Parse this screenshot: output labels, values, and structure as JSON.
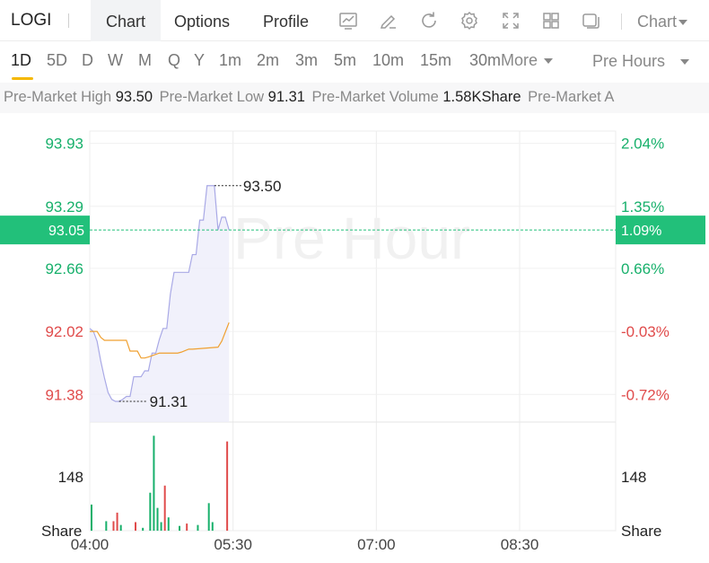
{
  "header": {
    "symbol": "LOGI",
    "tabs": [
      {
        "label": "Chart",
        "active": true
      },
      {
        "label": "Options",
        "active": false
      },
      {
        "label": "Profile",
        "active": false
      }
    ],
    "toolbar_icons": [
      "indicator-icon",
      "draw-icon",
      "refresh-icon",
      "settings-icon",
      "fullscreen-icon",
      "layout-grid-icon",
      "window-icon"
    ],
    "chart_type_label": "Chart"
  },
  "periods": {
    "items": [
      "1D",
      "5D",
      "D",
      "W",
      "M",
      "Q",
      "Y",
      "1m",
      "2m",
      "3m",
      "5m",
      "10m",
      "15m",
      "30m"
    ],
    "active": "1D",
    "more_label": "More",
    "session_label": "Pre Hours"
  },
  "stats": [
    {
      "label": "Pre-Market High",
      "value": "93.50"
    },
    {
      "label": "Pre-Market Low",
      "value": "91.31"
    },
    {
      "label": "Pre-Market Volume",
      "value": "1.58KShare"
    },
    {
      "label": "Pre-Market A",
      "value": ""
    }
  ],
  "chart": {
    "watermark": "Pre Hour",
    "current_price": "93.05",
    "current_change": "1.09%",
    "high_label": "93.50",
    "low_label": "91.31",
    "volume_tick": "148",
    "volume_unit": "Share",
    "price_ticks": [
      {
        "price": "93.93",
        "pct": "2.04%",
        "dir": "up"
      },
      {
        "price": "93.29",
        "pct": "1.35%",
        "dir": "up"
      },
      {
        "price": "92.66",
        "pct": "0.66%",
        "dir": "up"
      },
      {
        "price": "92.02",
        "pct": "-0.03%",
        "dir": "down"
      },
      {
        "price": "91.38",
        "pct": "-0.72%",
        "dir": "down"
      }
    ],
    "time_labels": [
      "04:00",
      "05:30",
      "07:00",
      "08:30"
    ],
    "colors": {
      "up": "#17b06b",
      "down": "#e04b4b",
      "current_bg": "#22c07a",
      "price_line": "#a9a9e6",
      "avg_line": "#f0a030"
    }
  },
  "chart_data": {
    "type": "line",
    "x_range": [
      "04:00",
      "09:30"
    ],
    "ylim": [
      91.1,
      94.2
    ],
    "series": [],
    "price": [
      {
        "t": 0,
        "v": 92.05
      },
      {
        "t": 1,
        "v": 92.02
      },
      {
        "t": 2,
        "v": 91.92
      },
      {
        "t": 3,
        "v": 91.72
      },
      {
        "t": 4,
        "v": 91.55
      },
      {
        "t": 5,
        "v": 91.4
      },
      {
        "t": 6,
        "v": 91.33
      },
      {
        "t": 7,
        "v": 91.31
      },
      {
        "t": 8,
        "v": 91.31
      },
      {
        "t": 9,
        "v": 91.33
      },
      {
        "t": 10,
        "v": 91.36
      },
      {
        "t": 11,
        "v": 91.36
      },
      {
        "t": 12,
        "v": 91.56
      },
      {
        "t": 13,
        "v": 91.56
      },
      {
        "t": 14,
        "v": 91.56
      },
      {
        "t": 15,
        "v": 91.62
      },
      {
        "t": 16,
        "v": 91.62
      },
      {
        "t": 17,
        "v": 91.8
      },
      {
        "t": 18,
        "v": 91.8
      },
      {
        "t": 19,
        "v": 91.94
      },
      {
        "t": 20,
        "v": 92.05
      },
      {
        "t": 21,
        "v": 92.05
      },
      {
        "t": 22,
        "v": 92.4
      },
      {
        "t": 23,
        "v": 92.62
      },
      {
        "t": 24,
        "v": 92.62
      },
      {
        "t": 25,
        "v": 92.62
      },
      {
        "t": 26,
        "v": 92.62
      },
      {
        "t": 27,
        "v": 92.62
      },
      {
        "t": 28,
        "v": 92.8
      },
      {
        "t": 29,
        "v": 92.8
      },
      {
        "t": 30,
        "v": 93.15
      },
      {
        "t": 31,
        "v": 93.15
      },
      {
        "t": 32,
        "v": 93.5
      },
      {
        "t": 33,
        "v": 93.5
      },
      {
        "t": 34,
        "v": 93.5
      },
      {
        "t": 35,
        "v": 93.05
      },
      {
        "t": 36,
        "v": 93.18
      },
      {
        "t": 37,
        "v": 93.18
      },
      {
        "t": 38,
        "v": 93.05
      }
    ],
    "avg_price": [
      {
        "t": 0,
        "v": 92.02
      },
      {
        "t": 2,
        "v": 92.02
      },
      {
        "t": 3,
        "v": 91.96
      },
      {
        "t": 4,
        "v": 91.93
      },
      {
        "t": 6,
        "v": 91.93
      },
      {
        "t": 7,
        "v": 91.93
      },
      {
        "t": 8,
        "v": 91.93
      },
      {
        "t": 9,
        "v": 91.93
      },
      {
        "t": 10,
        "v": 91.93
      },
      {
        "t": 11,
        "v": 91.82
      },
      {
        "t": 13,
        "v": 91.82
      },
      {
        "t": 14,
        "v": 91.75
      },
      {
        "t": 15,
        "v": 91.75
      },
      {
        "t": 16,
        "v": 91.76
      },
      {
        "t": 19,
        "v": 91.8
      },
      {
        "t": 24,
        "v": 91.8
      },
      {
        "t": 25,
        "v": 91.81
      },
      {
        "t": 27,
        "v": 91.84
      },
      {
        "t": 28,
        "v": 91.84
      },
      {
        "t": 35,
        "v": 91.86
      },
      {
        "t": 36,
        "v": 91.92
      },
      {
        "t": 38,
        "v": 92.11
      }
    ],
    "volume": [
      {
        "t": 0,
        "v": 55,
        "dir": "up"
      },
      {
        "t": 4,
        "v": 20,
        "dir": "up"
      },
      {
        "t": 6,
        "v": 20,
        "dir": "down"
      },
      {
        "t": 7,
        "v": 38,
        "dir": "down"
      },
      {
        "t": 8,
        "v": 12,
        "dir": "up"
      },
      {
        "t": 12,
        "v": 18,
        "dir": "down"
      },
      {
        "t": 14,
        "v": 6,
        "dir": "up"
      },
      {
        "t": 16,
        "v": 80,
        "dir": "up"
      },
      {
        "t": 17,
        "v": 200,
        "dir": "up"
      },
      {
        "t": 18,
        "v": 48,
        "dir": "up"
      },
      {
        "t": 19,
        "v": 18,
        "dir": "up"
      },
      {
        "t": 20,
        "v": 95,
        "dir": "down"
      },
      {
        "t": 21,
        "v": 28,
        "dir": "up"
      },
      {
        "t": 24,
        "v": 10,
        "dir": "up"
      },
      {
        "t": 26,
        "v": 15,
        "dir": "down"
      },
      {
        "t": 29,
        "v": 12,
        "dir": "up"
      },
      {
        "t": 32,
        "v": 58,
        "dir": "up"
      },
      {
        "t": 33,
        "v": 18,
        "dir": "up"
      },
      {
        "t": 37,
        "v": 188,
        "dir": "down"
      }
    ]
  }
}
